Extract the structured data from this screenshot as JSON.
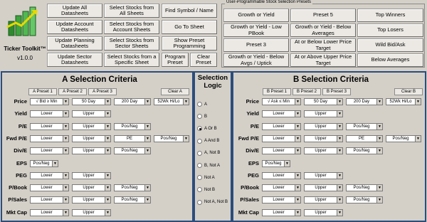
{
  "app": {
    "title": "Ticker Toolkit™",
    "version": "v1.0.0"
  },
  "top_buttons": [
    "Update All\nDatasheets",
    "Update Account\nDatasheets",
    "Update Planning\nDatasheets",
    "Update Sector\nDatasheets",
    "Select Stocks from\nAll Sheets",
    "Select Stocks from\nAccount Sheets",
    "Select Stocks from\nSector Sheets",
    "Select Stocks from a\nSpecific Sheet",
    "Find Symbol / Name",
    "Go To Sheet",
    "Show Preset\nProgramming",
    "Program\nPreset",
    "Clear\nPreset"
  ],
  "presets": {
    "frame_label": "User-Programmable Stock Selection Presets",
    "buttons": [
      "Growth or Yield",
      "Growth or Yield - Low\nPBook",
      "Preset 3",
      "Growth or Yield - Below\nAvgs / Uptick",
      "Preset 5",
      "Growth or Yield - Below\nAverages",
      "At or Below Lower Price\nTarget",
      "At or Above Upper Price\nTarget",
      "Top Winners",
      "Top Losers",
      "Wild Bid/Ask",
      "Below Averages"
    ]
  },
  "section_a": {
    "title": "A Selection Criteria",
    "preset_buttons": [
      "A Preset 1",
      "A Preset 2",
      "A Preset 3"
    ],
    "clear_label": "Clear A",
    "rows": [
      {
        "label": "Price",
        "check": "√",
        "fields": [
          "Bid ≥ Min",
          "50 Day",
          "200 Day",
          "52Wk Hi/Lo"
        ]
      },
      {
        "label": "Yield",
        "fields": [
          "Lower",
          "Upper"
        ]
      },
      {
        "label": "P/E",
        "fields": [
          "Lower",
          "Upper",
          "Pos/Neg"
        ]
      },
      {
        "label": "Fwd P/E",
        "fields": [
          "Lower",
          "Upper",
          "PE",
          "Pos/Neg"
        ]
      },
      {
        "label": "Div/E",
        "fields": [
          "Lower",
          "Upper",
          "Pos/Neg"
        ]
      },
      {
        "label": "EPS",
        "fields": [
          "Pos/Neg"
        ]
      },
      {
        "label": "PEG",
        "fields": [
          "Lower",
          "Upper"
        ]
      },
      {
        "label": "P/Book",
        "fields": [
          "Lower",
          "Upper",
          "Pos/Neg"
        ]
      },
      {
        "label": "P/Sales",
        "fields": [
          "Lower",
          "Upper",
          "Pos/Neg"
        ]
      },
      {
        "label": "Mkt Cap",
        "fields": [
          "Lower",
          "Upper"
        ]
      }
    ]
  },
  "selection_logic": {
    "title": "Selection\nLogic",
    "options": [
      "A",
      "B",
      "A Or B",
      "A And B",
      "A, Not B",
      "B, Not A",
      "Not A",
      "Not B",
      "Not A, Not B"
    ],
    "selected": "A Or B"
  },
  "section_b": {
    "title": "B Selection Criteria",
    "preset_buttons": [
      "B Preset 1",
      "B Preset 2",
      "B Preset 3"
    ],
    "clear_label": "Clear B",
    "rows": [
      {
        "label": "Price",
        "check": "√",
        "fields": [
          "Ask ≤ Min",
          "50 Day",
          "200 Day",
          "52Wk Hi/Lo"
        ]
      },
      {
        "label": "Yield",
        "fields": [
          "Lower",
          "Upper"
        ]
      },
      {
        "label": "P/E",
        "fields": [
          "Lower",
          "Upper",
          "Pos/Neg"
        ]
      },
      {
        "label": "Fwd P/E",
        "fields": [
          "Lower",
          "Upper",
          "PE",
          "Pos/Neg"
        ]
      },
      {
        "label": "Div/E",
        "fields": [
          "Lower",
          "Upper",
          "Pos/Neg"
        ]
      },
      {
        "label": "EPS",
        "fields": [
          "Pos/Neg"
        ]
      },
      {
        "label": "PEG",
        "fields": [
          "Lower",
          "Upper"
        ]
      },
      {
        "label": "P/Book",
        "fields": [
          "Lower",
          "Upper",
          "Pos/Neg"
        ]
      },
      {
        "label": "P/Sales",
        "fields": [
          "Lower",
          "Upper",
          "Pos/Neg"
        ]
      },
      {
        "label": "Mkt Cap",
        "fields": [
          "Lower",
          "Upper"
        ]
      }
    ]
  },
  "colors": {
    "panel_border": "#2c4c7c",
    "background": "#d4d0c8"
  }
}
